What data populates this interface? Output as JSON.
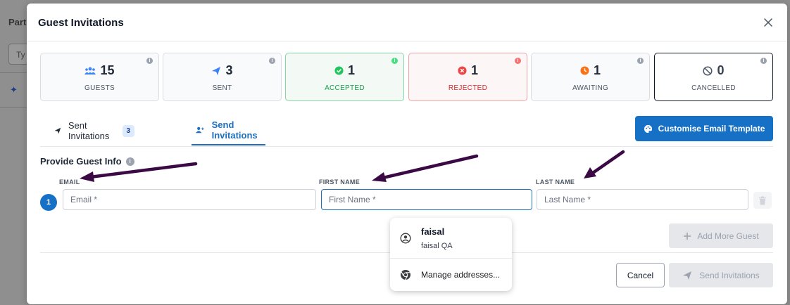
{
  "background": {
    "label": "Part",
    "input_value": "Ty"
  },
  "modal": {
    "title": "Guest Invitations"
  },
  "stats": [
    {
      "value": "15",
      "label": "GUESTS",
      "icon": "users-icon",
      "color": "#3b82f6"
    },
    {
      "value": "3",
      "label": "SENT",
      "icon": "paper-plane-icon",
      "color": "#3b82f6"
    },
    {
      "value": "1",
      "label": "ACCEPTED",
      "icon": "check-circle-icon",
      "color": "#22c55e"
    },
    {
      "value": "1",
      "label": "REJECTED",
      "icon": "x-circle-icon",
      "color": "#ef4444"
    },
    {
      "value": "1",
      "label": "AWAITING",
      "icon": "clock-icon",
      "color": "#f97316"
    },
    {
      "value": "0",
      "label": "CANCELLED",
      "icon": "ban-icon",
      "color": "#374151"
    }
  ],
  "tabs": {
    "sent_label": "Sent Invitations",
    "sent_count": "3",
    "send_label": "Send Invitations"
  },
  "customise_button": "Customise Email Template",
  "form": {
    "section_title": "Provide Guest Info",
    "columns": {
      "email": "EMAIL",
      "first_name": "FIRST NAME",
      "last_name": "LAST NAME"
    },
    "rows": [
      {
        "index": "1",
        "email_placeholder": "Email *",
        "first_name_placeholder": "First Name *",
        "last_name_placeholder": "Last Name *"
      }
    ],
    "add_more_label": "Add More Guest",
    "cancel_label": "Cancel",
    "send_label": "Send Invitations"
  },
  "autofill": {
    "profile_name": "faisal",
    "profile_sub": "faisal QA",
    "manage_label": "Manage addresses..."
  },
  "colors": {
    "primary": "#1670c5",
    "annotation_arrow": "#3b0a45"
  }
}
